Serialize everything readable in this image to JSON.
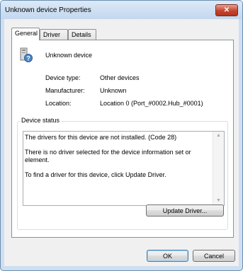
{
  "window": {
    "title": "Unknown device Properties",
    "close_glyph": "✕"
  },
  "tabs": [
    "General",
    "Driver",
    "Details"
  ],
  "device": {
    "icon": "unknown-device-icon",
    "name": "Unknown device"
  },
  "properties": [
    {
      "label": "Device type:",
      "value": "Other devices"
    },
    {
      "label": "Manufacturer:",
      "value": "Unknown"
    },
    {
      "label": "Location:",
      "value": "Location 0 (Port_#0002.Hub_#0001)"
    }
  ],
  "device_status": {
    "title": "Device status",
    "text": "The drivers for this device are not installed. (Code 28)\n\nThere is no driver selected for the device information set or element.\n\nTo find a driver for this device, click Update Driver.",
    "update_button": "Update Driver..."
  },
  "buttons": {
    "ok": "OK",
    "cancel": "Cancel"
  }
}
